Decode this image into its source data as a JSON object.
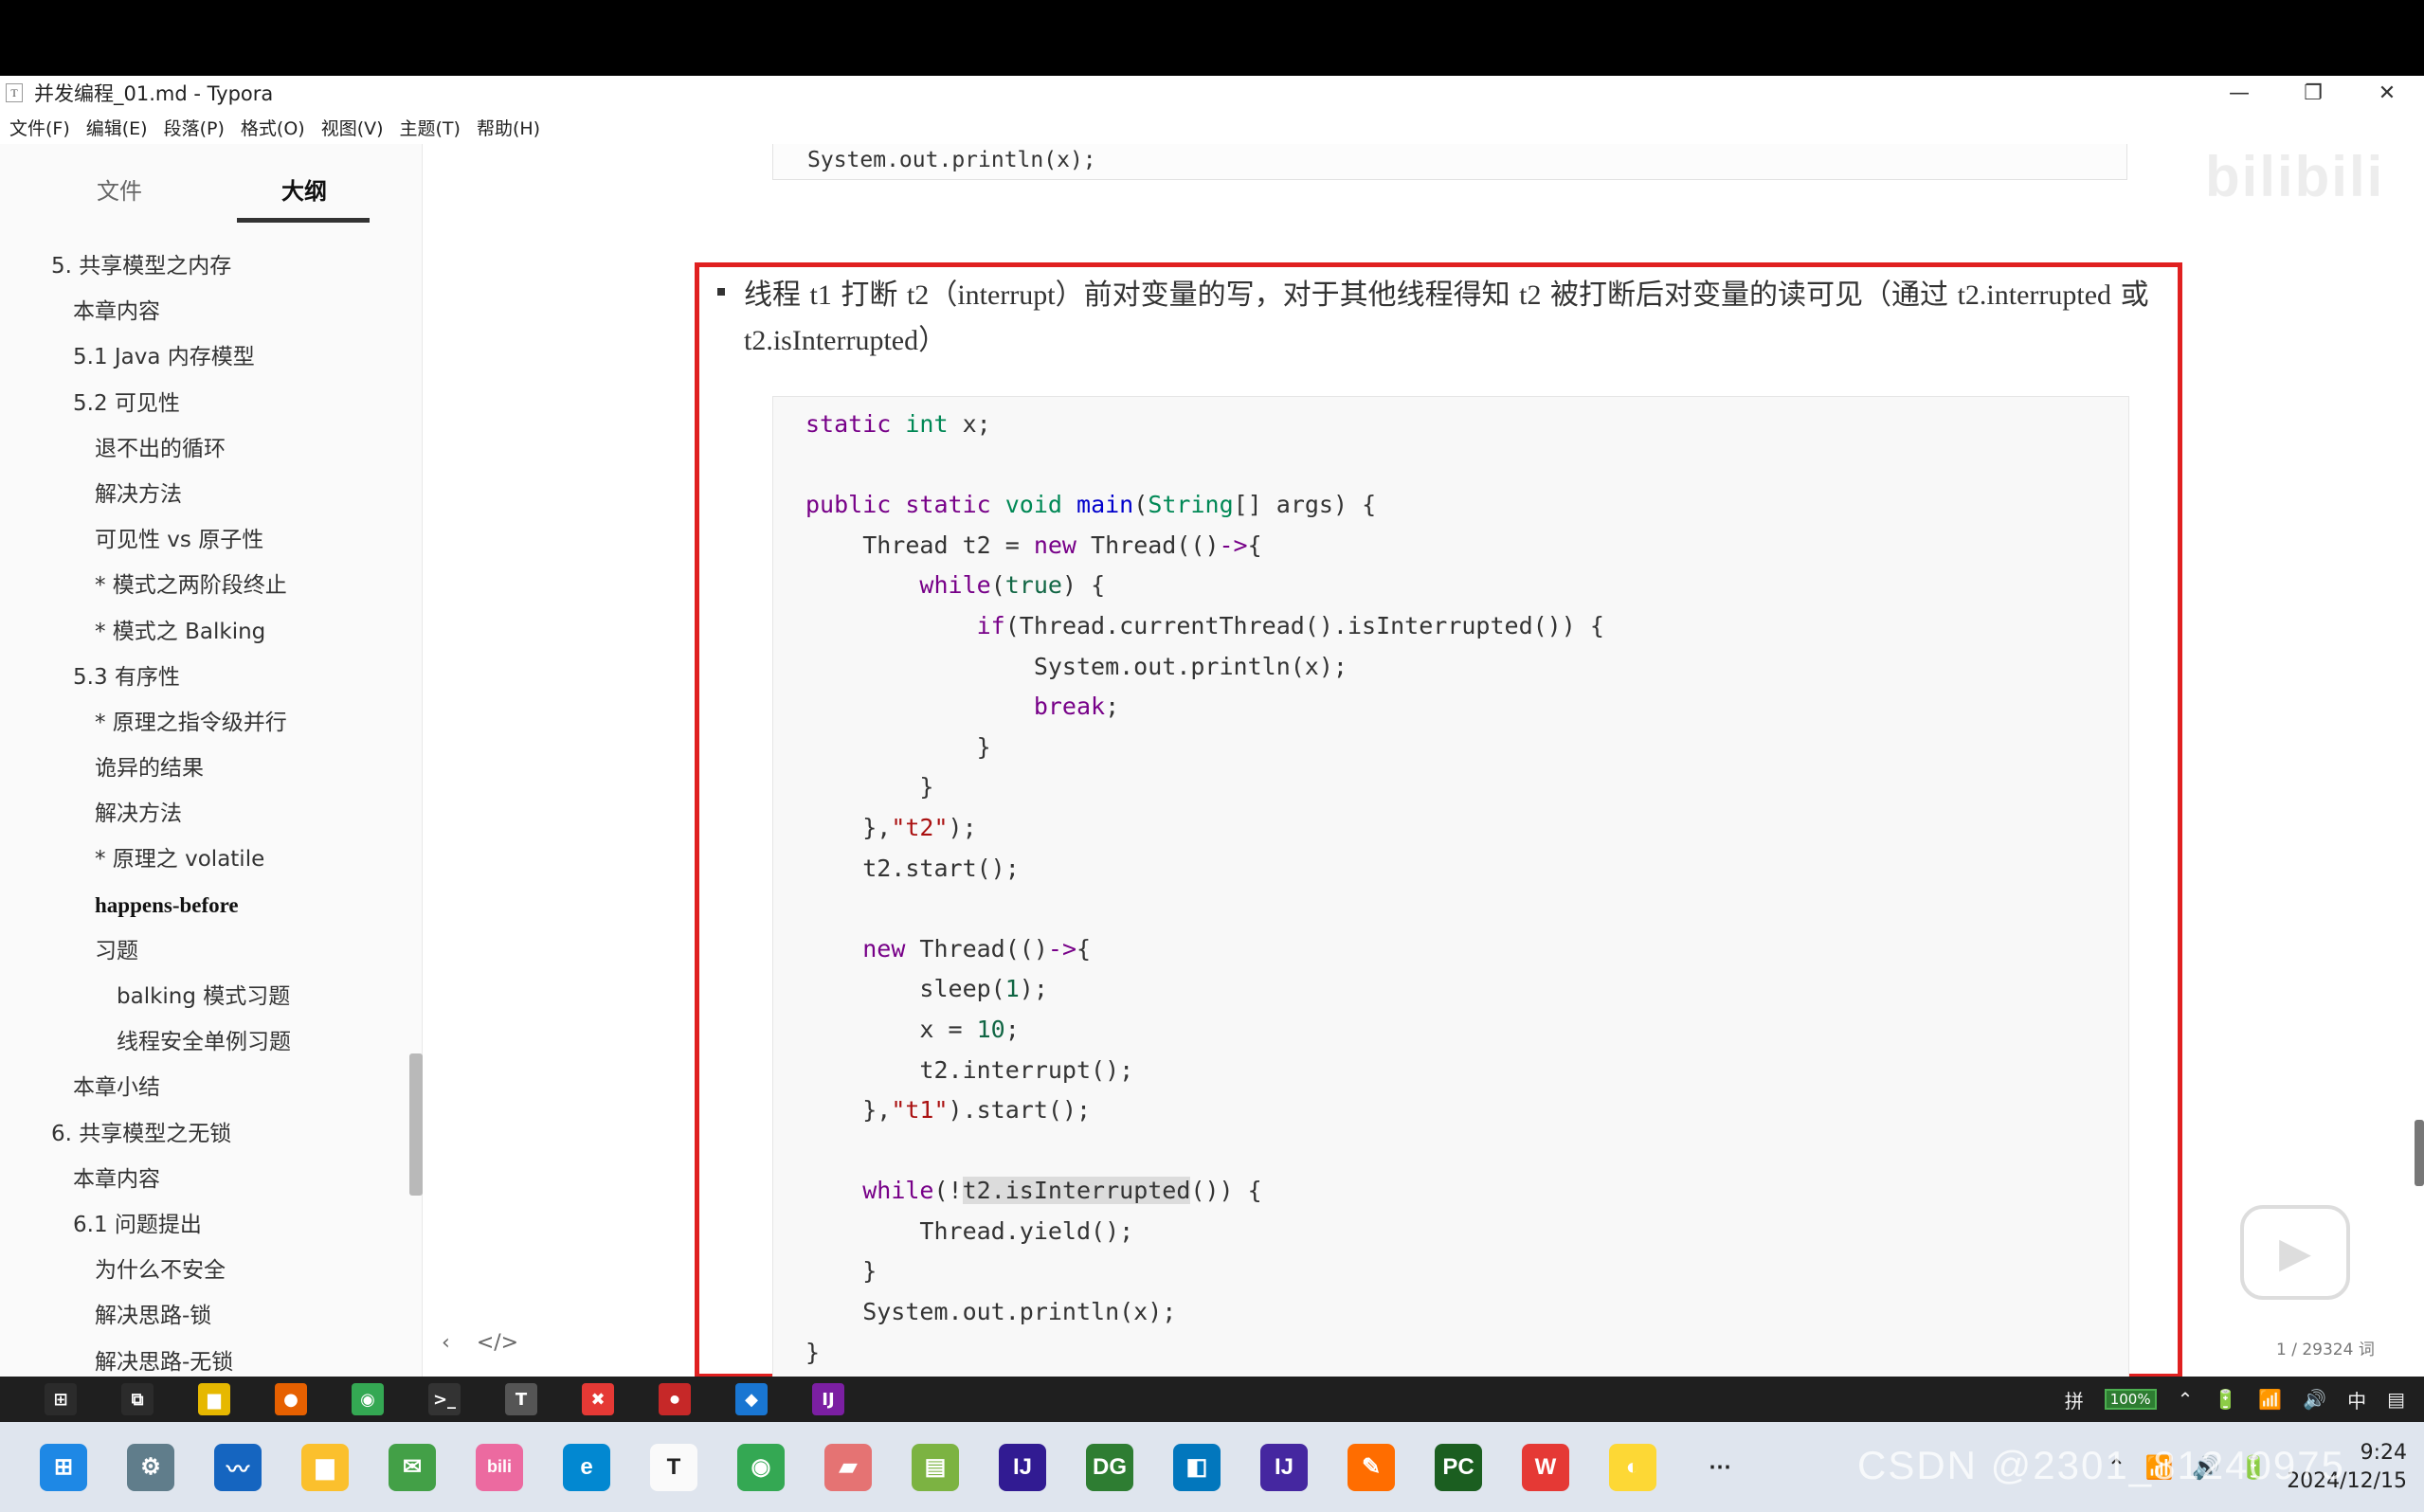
{
  "window": {
    "title": "并发编程_01.md - Typora",
    "app_icon": "T",
    "controls": [
      "—",
      "❐",
      "✕"
    ]
  },
  "menu": [
    "文件(F)",
    "编辑(E)",
    "段落(P)",
    "格式(O)",
    "视图(V)",
    "主题(T)",
    "帮助(H)"
  ],
  "sidebar": {
    "tabs": [
      "文件",
      "大纲"
    ],
    "active_tab": 1,
    "outline": [
      {
        "level": 1,
        "text": "5. 共享模型之内存"
      },
      {
        "level": 2,
        "text": "本章内容"
      },
      {
        "level": 2,
        "text": "5.1 Java 内存模型"
      },
      {
        "level": 2,
        "text": "5.2 可见性"
      },
      {
        "level": 3,
        "text": "退不出的循环"
      },
      {
        "level": 3,
        "text": "解决方法"
      },
      {
        "level": 3,
        "text": "可见性 vs 原子性"
      },
      {
        "level": 3,
        "text": "* 模式之两阶段终止"
      },
      {
        "level": 3,
        "text": "* 模式之 Balking"
      },
      {
        "level": 2,
        "text": "5.3 有序性"
      },
      {
        "level": 3,
        "text": "* 原理之指令级并行"
      },
      {
        "level": 3,
        "text": "诡异的结果"
      },
      {
        "level": 3,
        "text": "解决方法"
      },
      {
        "level": 3,
        "text": "* 原理之 volatile"
      },
      {
        "level": 3,
        "text": "happens-before",
        "bold": true
      },
      {
        "level": 3,
        "text": "习题"
      },
      {
        "level": 4,
        "text": "balking 模式习题"
      },
      {
        "level": 4,
        "text": "线程安全单例习题"
      },
      {
        "level": 2,
        "text": "本章小结"
      },
      {
        "level": 1,
        "text": "6. 共享模型之无锁"
      },
      {
        "level": 2,
        "text": "本章内容"
      },
      {
        "level": 2,
        "text": "6.1 问题提出"
      },
      {
        "level": 3,
        "text": "为什么不安全"
      },
      {
        "level": 3,
        "text": "解决思路-锁"
      },
      {
        "level": 3,
        "text": "解决思路-无锁"
      }
    ],
    "footer_icons": [
      "‹",
      "</>"
    ]
  },
  "editor": {
    "prev_code_line": "System.out.println(x);",
    "watermark": "bilibili",
    "paragraph_parts": [
      {
        "text": "线程 "
      },
      {
        "text": "t1",
        "serif": true
      },
      {
        "text": " 打断 "
      },
      {
        "text": "t2",
        "serif": true
      },
      {
        "text": "（"
      },
      {
        "text": "interrupt",
        "serif": true
      },
      {
        "text": "）前对变量的写，对于其他线程得知 "
      },
      {
        "text": "t2",
        "serif": true
      },
      {
        "text": " 被打断后对变量的读可见（通过 "
      },
      {
        "text": "t2.interrupted",
        "serif": true
      },
      {
        "text": " 或 "
      },
      {
        "text": "t2.isInterrupted",
        "serif": true
      },
      {
        "text": "）"
      }
    ],
    "code_lines": [
      [
        [
          "kw",
          "static"
        ],
        [
          "",
          " "
        ],
        [
          "ty",
          "int"
        ],
        [
          "",
          " x;"
        ]
      ],
      [],
      [
        [
          "kw",
          "public"
        ],
        [
          "",
          " "
        ],
        [
          "kw",
          "static"
        ],
        [
          "",
          " "
        ],
        [
          "ty",
          "void"
        ],
        [
          "",
          " "
        ],
        [
          "fn",
          "main"
        ],
        [
          "",
          "("
        ],
        [
          "ty",
          "String"
        ],
        [
          "",
          "[] args) {"
        ]
      ],
      [
        [
          "",
          "    Thread t2 = "
        ],
        [
          "kw",
          "new"
        ],
        [
          "",
          " Thread(()"
        ],
        [
          "kw",
          "->"
        ],
        [
          "",
          "{"
        ]
      ],
      [
        [
          "",
          "        "
        ],
        [
          "kw",
          "while"
        ],
        [
          "",
          "("
        ],
        [
          "nm",
          "true"
        ],
        [
          "",
          ") {"
        ]
      ],
      [
        [
          "",
          "            "
        ],
        [
          "kw",
          "if"
        ],
        [
          "",
          "(Thread.currentThread().isInterrupted()) {"
        ]
      ],
      [
        [
          "",
          "                System.out.println(x);"
        ]
      ],
      [
        [
          "",
          "                "
        ],
        [
          "kw",
          "break"
        ],
        [
          "",
          ";"
        ]
      ],
      [
        [
          "",
          "            }"
        ]
      ],
      [
        [
          "",
          "        }"
        ]
      ],
      [
        [
          "",
          "    },"
        ],
        [
          "st",
          "\"t2\""
        ],
        [
          "",
          ");"
        ]
      ],
      [
        [
          "",
          "    t2.start();"
        ]
      ],
      [],
      [
        [
          "",
          "    "
        ],
        [
          "kw",
          "new"
        ],
        [
          "",
          " Thread(()"
        ],
        [
          "kw",
          "->"
        ],
        [
          "",
          "{"
        ]
      ],
      [
        [
          "",
          "        sleep("
        ],
        [
          "nm",
          "1"
        ],
        [
          "",
          ");"
        ]
      ],
      [
        [
          "",
          "        x = "
        ],
        [
          "nm",
          "10"
        ],
        [
          "",
          ";"
        ]
      ],
      [
        [
          "",
          "        t2.interrupt();"
        ]
      ],
      [
        [
          "",
          "    },"
        ],
        [
          "st",
          "\"t1\""
        ],
        [
          "",
          ").start();"
        ]
      ],
      [],
      [
        [
          "",
          "    "
        ],
        [
          "kw",
          "while"
        ],
        [
          "",
          "(!"
        ],
        [
          "sel",
          "t2.isInterrupted"
        ],
        [
          "",
          "()) {"
        ]
      ],
      [
        [
          "",
          "        Thread.yield();"
        ]
      ],
      [
        [
          "",
          "    }"
        ]
      ],
      [
        [
          "",
          "    System.out.println(x);"
        ]
      ],
      [
        [
          "",
          "}"
        ]
      ]
    ],
    "word_count": "1 / 29324 词",
    "play_icon": "▶"
  },
  "taskbar_top": {
    "icons": [
      {
        "name": "windows-start",
        "glyph": "⊞",
        "color": "#2b2b2b"
      },
      {
        "name": "task-view",
        "glyph": "⧉",
        "color": "#2b2b2b"
      },
      {
        "name": "file-explorer",
        "glyph": "▆",
        "color": "#e6b800"
      },
      {
        "name": "firefox",
        "glyph": "●",
        "color": "#e66000"
      },
      {
        "name": "chrome",
        "glyph": "◉",
        "color": "#34a853"
      },
      {
        "name": "terminal",
        "glyph": ">_",
        "color": "#333"
      },
      {
        "name": "typora",
        "glyph": "T",
        "color": "#555"
      },
      {
        "name": "xmind",
        "glyph": "✖",
        "color": "#e53935"
      },
      {
        "name": "record",
        "glyph": "⏺",
        "color": "#c62828"
      },
      {
        "name": "vscode",
        "glyph": "◆",
        "color": "#1976d2"
      },
      {
        "name": "intellij",
        "glyph": "IJ",
        "color": "#7b1fa2"
      }
    ],
    "tray": [
      "拼",
      "100%",
      "⌃",
      "🔋",
      "📶",
      "🔊",
      "中",
      "▤"
    ]
  },
  "taskbar_bottom": {
    "icons": [
      {
        "name": "windows-start",
        "glyph": "⊞",
        "color": "#1e88e5"
      },
      {
        "name": "settings",
        "glyph": "⚙",
        "color": "#607d8b"
      },
      {
        "name": "monitor",
        "glyph": "〰",
        "color": "#1565c0"
      },
      {
        "name": "folder",
        "glyph": "▆",
        "color": "#fbc02d"
      },
      {
        "name": "wechat",
        "glyph": "✉",
        "color": "#43a047"
      },
      {
        "name": "bilibili",
        "glyph": "bili",
        "color": "#ec6aa0"
      },
      {
        "name": "edge",
        "glyph": "e",
        "color": "#0288d1"
      },
      {
        "name": "typora",
        "glyph": "T",
        "color": "#fafafa"
      },
      {
        "name": "chrome",
        "glyph": "◉",
        "color": "#34a853"
      },
      {
        "name": "eraser",
        "glyph": "▰",
        "color": "#e57373"
      },
      {
        "name": "charts",
        "glyph": "▤",
        "color": "#7cb342"
      },
      {
        "name": "intellij",
        "glyph": "IJ",
        "color": "#311b92"
      },
      {
        "name": "datagrip",
        "glyph": "DG",
        "color": "#2e7d32"
      },
      {
        "name": "network",
        "glyph": "◧",
        "color": "#0277bd"
      },
      {
        "name": "intellij-2",
        "glyph": "IJ",
        "color": "#4527a0"
      },
      {
        "name": "postman",
        "glyph": "✎",
        "color": "#ff6d00"
      },
      {
        "name": "pycharm",
        "glyph": "PC",
        "color": "#1b5e20"
      },
      {
        "name": "wps",
        "glyph": "W",
        "color": "#e53935"
      },
      {
        "name": "chat",
        "glyph": "◐",
        "color": "#fdd835"
      },
      {
        "name": "more",
        "glyph": "⋯",
        "color": "#dfe5ee"
      }
    ],
    "tray": [
      "⌃",
      "📶",
      "🔊",
      "🔋"
    ],
    "time": "9:24",
    "date": "2024/12/15",
    "watermark": "CSDN @2301_81240975"
  }
}
